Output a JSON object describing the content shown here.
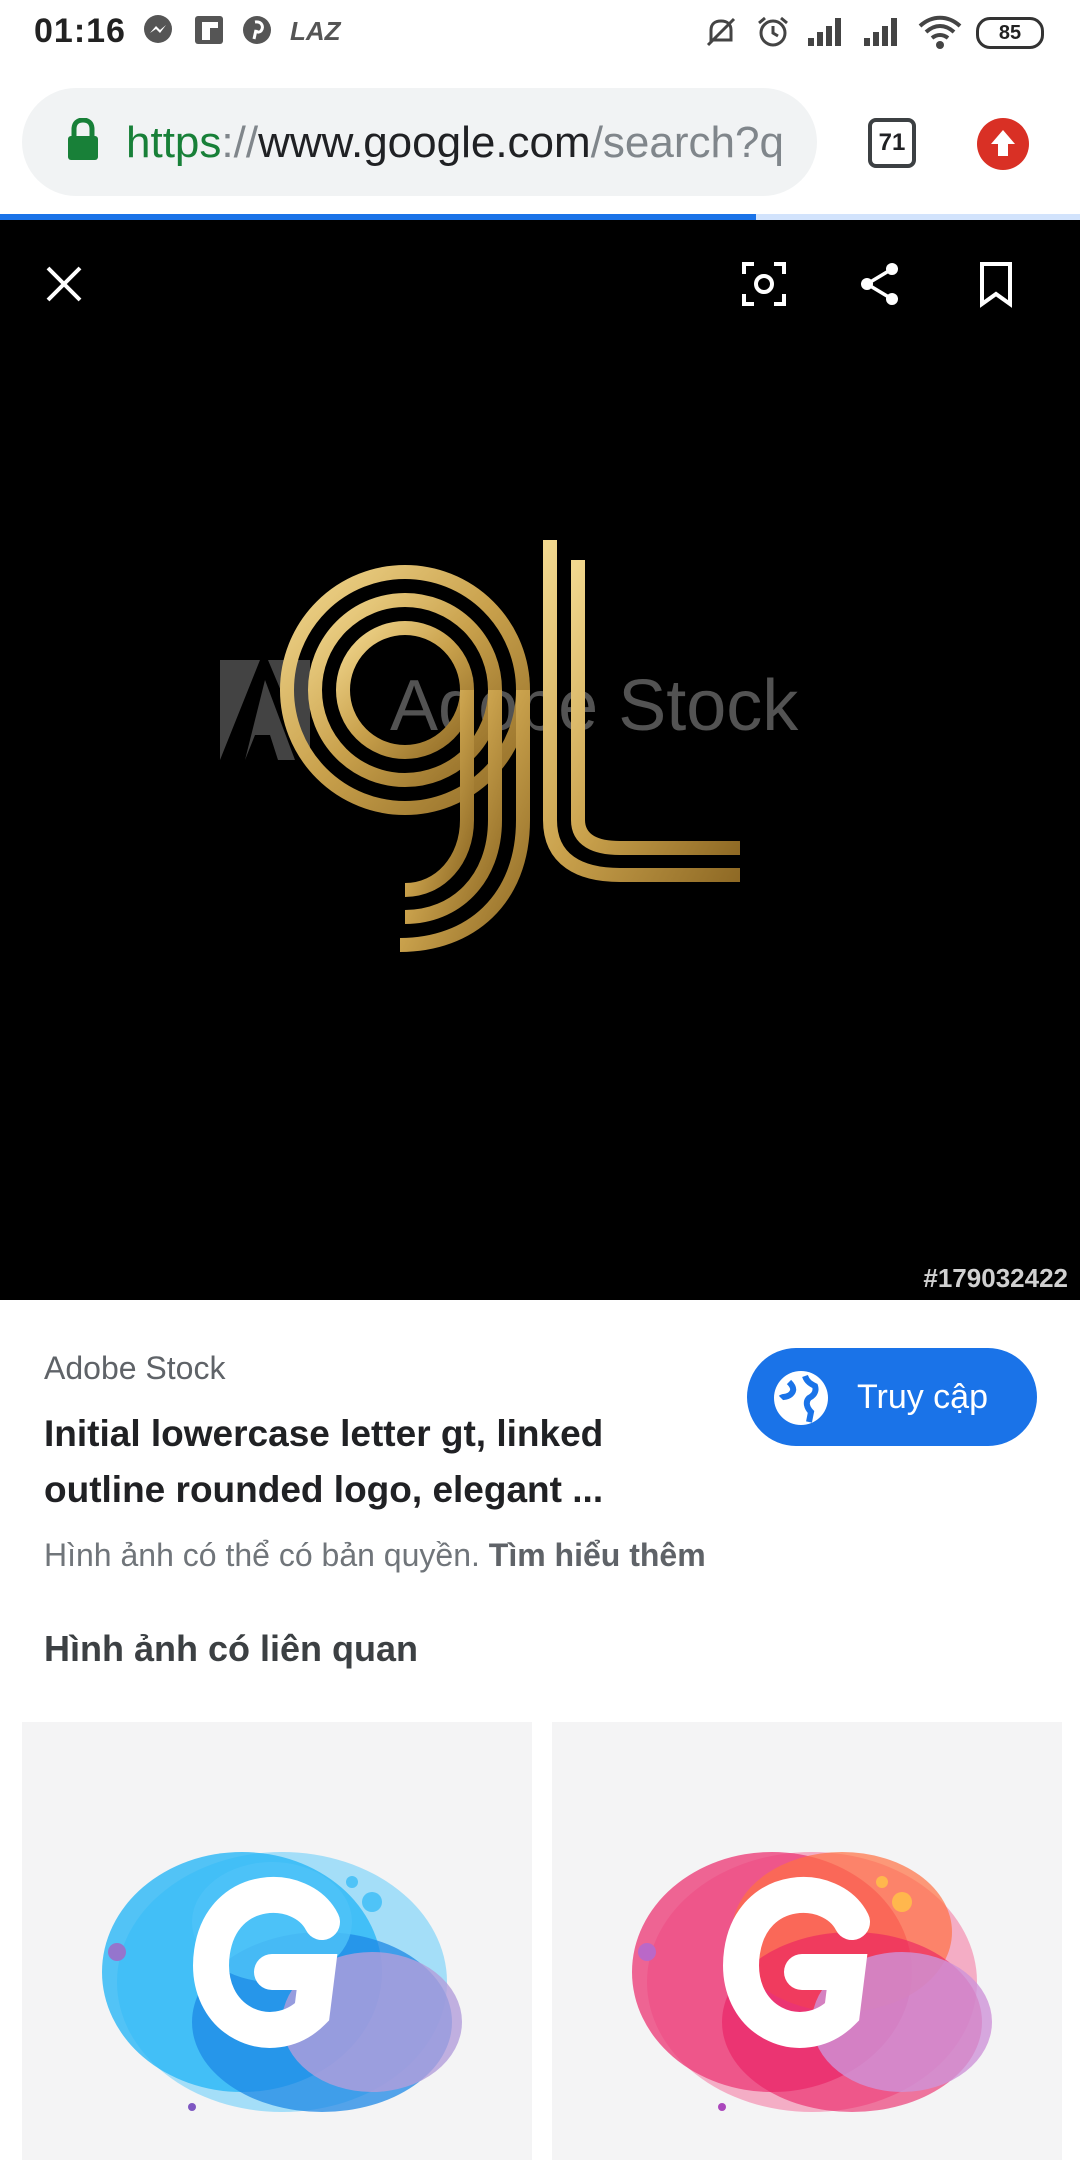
{
  "status_bar": {
    "time": "01:16",
    "lazada_label": "LAZ",
    "battery": "85",
    "icons": [
      "messenger-icon",
      "flipboard-icon",
      "pinterest-icon",
      "lazada-icon",
      "mute-icon",
      "alarm-icon",
      "signal-icon",
      "signal-icon",
      "wifi-icon",
      "battery-icon"
    ]
  },
  "browser": {
    "url_scheme": "https",
    "url_separator": "://",
    "url_host": "www.google.com",
    "url_path": "/search?q",
    "tab_count": "71",
    "load_progress": 0.7,
    "colors": {
      "secure": "#188038",
      "progress": "#1a73e8",
      "update": "#d93025"
    }
  },
  "viewer": {
    "buttons": [
      "close-icon",
      "lens-icon",
      "share-icon",
      "bookmark-icon"
    ],
    "watermark": "Adobe Stock",
    "image_id": "#179032422"
  },
  "result": {
    "source": "Adobe Stock",
    "title": "Initial lowercase letter gt, linked outline rounded logo, elegant ...",
    "visit_label": "Truy cập",
    "copyright_text": "Hình ảnh có thể có bản quyền.",
    "learn_more": "Tìm hiểu thêm"
  },
  "related": {
    "heading": "Hình ảnh có liên quan",
    "tiles": [
      {
        "colors": [
          "#29b6f6",
          "#1e88e5",
          "#b39ddb"
        ]
      },
      {
        "colors": [
          "#ec407a",
          "#ff7043",
          "#ce93d8"
        ]
      }
    ]
  }
}
